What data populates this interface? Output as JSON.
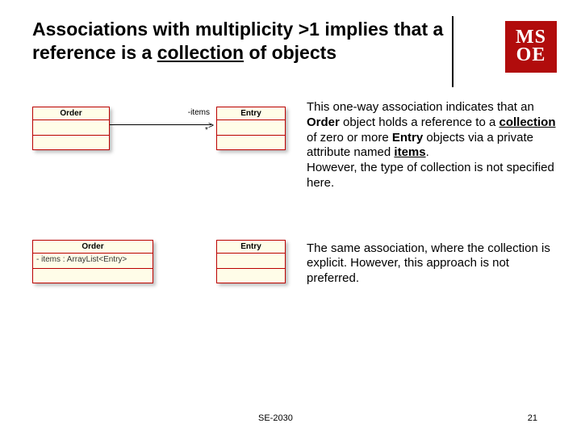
{
  "title_plain": "Associations with multiplicity >1 implies that a reference is a ",
  "title_underlined": "collection",
  "title_tail": " of objects",
  "logo": {
    "line1": "MS",
    "line2": "OE"
  },
  "diagram1": {
    "class_left": "Order",
    "class_right": "Entry",
    "assoc_label": "-items",
    "assoc_mult": "*"
  },
  "desc1_parts": {
    "p1": "This one-way association indicates that an ",
    "b1": "Order",
    "p2": " object holds a reference to a ",
    "u1": "collection",
    "p3": " of zero or more ",
    "b2": "Entry",
    "p4": " objects via a private attribute named ",
    "bu1": "items",
    "p5": ".",
    "p6": "However, the type of collection is not specified here."
  },
  "diagram2": {
    "class_left": "Order",
    "class_left_attr": "- items : ArrayList<Entry>",
    "class_right": "Entry"
  },
  "desc2_parts": {
    "p1": "The same association, where the collection is explicit. However, this approach is not preferred."
  },
  "footer": {
    "course": "SE-2030",
    "page": "21"
  }
}
